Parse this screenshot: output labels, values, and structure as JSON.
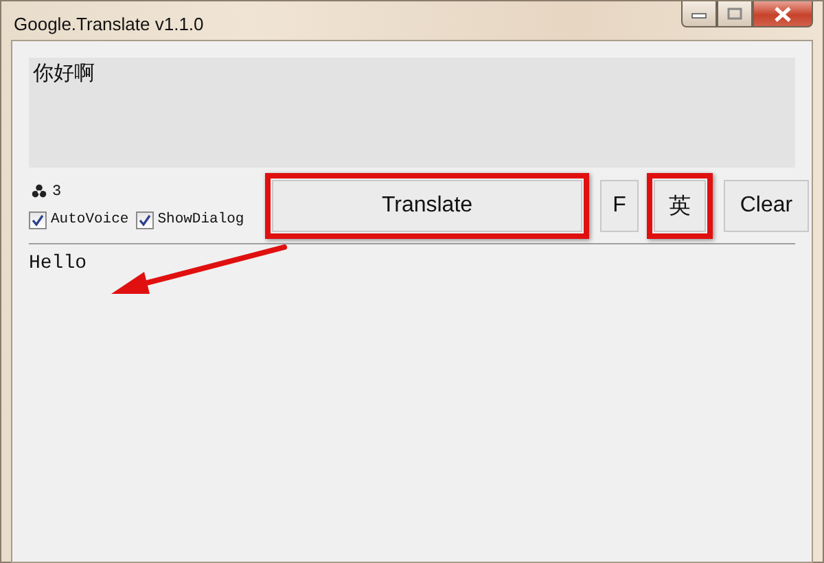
{
  "window": {
    "title": "Google.Translate v1.1.0"
  },
  "input": {
    "value": "你好啊"
  },
  "counter": "3",
  "checkboxes": [
    {
      "label": "AutoVoice",
      "checked": true
    },
    {
      "label": "ShowDialog",
      "checked": true
    }
  ],
  "buttons": [
    {
      "label": "Translate",
      "highlighted": true
    },
    {
      "label": "F",
      "highlighted": false
    },
    {
      "label": "英",
      "highlighted": true
    },
    {
      "label": "Clear",
      "highlighted": false
    }
  ],
  "output": "Hello"
}
